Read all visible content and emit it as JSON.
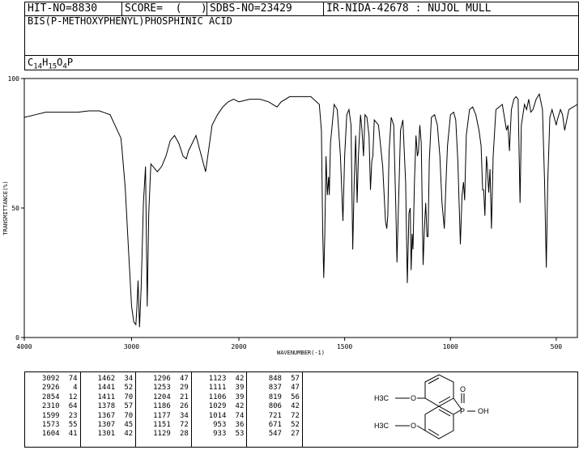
{
  "header": {
    "hit_no": "HIT-NO=8830",
    "score": "SCORE=  (   )",
    "sdbs_no": "SDBS-NO=23429",
    "ir_info": "IR-NIDA-42678 : NUJOL MULL"
  },
  "compound": {
    "name": "BIS(P-METHOXYPHENYL)PHOSPHINIC ACID",
    "formula_parts": [
      {
        "t": "C",
        "sub": false
      },
      {
        "t": "14",
        "sub": true
      },
      {
        "t": "H",
        "sub": false
      },
      {
        "t": "15",
        "sub": true
      },
      {
        "t": "O",
        "sub": false
      },
      {
        "t": "4",
        "sub": true
      },
      {
        "t": "P",
        "sub": false
      }
    ]
  },
  "chart_data": {
    "type": "line",
    "xlabel": "WAVENUMBER(-1)",
    "ylabel": "TRANSMITTANCE(%)",
    "xlim": [
      4000,
      400
    ],
    "ylim": [
      0,
      100
    ],
    "x_ticks": [
      4000,
      3000,
      2000,
      1500,
      1000,
      500
    ],
    "y_ticks": [
      0,
      50,
      100
    ],
    "series": [
      {
        "points": [
          [
            4000,
            85
          ],
          [
            3900,
            86
          ],
          [
            3800,
            87
          ],
          [
            3700,
            87
          ],
          [
            3600,
            87
          ],
          [
            3500,
            87
          ],
          [
            3400,
            87.5
          ],
          [
            3300,
            87.5
          ],
          [
            3200,
            86
          ],
          [
            3100,
            77
          ],
          [
            3092,
            74
          ],
          [
            3060,
            58
          ],
          [
            3030,
            35
          ],
          [
            3000,
            12
          ],
          [
            2980,
            6
          ],
          [
            2960,
            5
          ],
          [
            2950,
            12
          ],
          [
            2940,
            22
          ],
          [
            2926,
            4
          ],
          [
            2910,
            20
          ],
          [
            2890,
            52
          ],
          [
            2870,
            66
          ],
          [
            2854,
            12
          ],
          [
            2840,
            48
          ],
          [
            2820,
            67
          ],
          [
            2800,
            66
          ],
          [
            2760,
            64
          ],
          [
            2720,
            66
          ],
          [
            2680,
            70
          ],
          [
            2640,
            76
          ],
          [
            2600,
            78
          ],
          [
            2560,
            75
          ],
          [
            2520,
            70
          ],
          [
            2490,
            69
          ],
          [
            2470,
            72
          ],
          [
            2400,
            78
          ],
          [
            2310,
            64
          ],
          [
            2250,
            82
          ],
          [
            2200,
            86
          ],
          [
            2150,
            89
          ],
          [
            2100,
            91
          ],
          [
            2050,
            92
          ],
          [
            2000,
            91
          ],
          [
            1950,
            92
          ],
          [
            1900,
            92
          ],
          [
            1860,
            91
          ],
          [
            1820,
            89
          ],
          [
            1800,
            91
          ],
          [
            1760,
            93
          ],
          [
            1700,
            93
          ],
          [
            1660,
            93
          ],
          [
            1620,
            90
          ],
          [
            1610,
            80
          ],
          [
            1604,
            41
          ],
          [
            1599,
            23
          ],
          [
            1594,
            40
          ],
          [
            1588,
            70
          ],
          [
            1582,
            55
          ],
          [
            1576,
            62
          ],
          [
            1573,
            55
          ],
          [
            1567,
            75
          ],
          [
            1550,
            90
          ],
          [
            1535,
            88
          ],
          [
            1520,
            70
          ],
          [
            1508,
            45
          ],
          [
            1500,
            70
          ],
          [
            1490,
            86
          ],
          [
            1480,
            88
          ],
          [
            1470,
            82
          ],
          [
            1462,
            34
          ],
          [
            1455,
            60
          ],
          [
            1448,
            78
          ],
          [
            1441,
            52
          ],
          [
            1435,
            70
          ],
          [
            1425,
            86
          ],
          [
            1418,
            80
          ],
          [
            1411,
            70
          ],
          [
            1404,
            86
          ],
          [
            1395,
            85
          ],
          [
            1385,
            78
          ],
          [
            1378,
            57
          ],
          [
            1372,
            68
          ],
          [
            1367,
            70
          ],
          [
            1360,
            84
          ],
          [
            1340,
            82
          ],
          [
            1330,
            74
          ],
          [
            1320,
            66
          ],
          [
            1307,
            45
          ],
          [
            1301,
            42
          ],
          [
            1296,
            47
          ],
          [
            1290,
            72
          ],
          [
            1280,
            85
          ],
          [
            1268,
            82
          ],
          [
            1258,
            50
          ],
          [
            1253,
            29
          ],
          [
            1246,
            50
          ],
          [
            1236,
            80
          ],
          [
            1225,
            84
          ],
          [
            1212,
            60
          ],
          [
            1204,
            21
          ],
          [
            1196,
            48
          ],
          [
            1190,
            50
          ],
          [
            1186,
            26
          ],
          [
            1181,
            40
          ],
          [
            1177,
            34
          ],
          [
            1170,
            60
          ],
          [
            1163,
            78
          ],
          [
            1156,
            70
          ],
          [
            1151,
            72
          ],
          [
            1145,
            82
          ],
          [
            1138,
            75
          ],
          [
            1129,
            28
          ],
          [
            1123,
            42
          ],
          [
            1117,
            52
          ],
          [
            1111,
            39
          ],
          [
            1106,
            39
          ],
          [
            1100,
            68
          ],
          [
            1090,
            85
          ],
          [
            1075,
            86
          ],
          [
            1062,
            82
          ],
          [
            1050,
            70
          ],
          [
            1040,
            52
          ],
          [
            1029,
            42
          ],
          [
            1020,
            62
          ],
          [
            1014,
            74
          ],
          [
            1000,
            86
          ],
          [
            985,
            87
          ],
          [
            975,
            84
          ],
          [
            965,
            68
          ],
          [
            953,
            36
          ],
          [
            945,
            55
          ],
          [
            938,
            60
          ],
          [
            933,
            53
          ],
          [
            925,
            78
          ],
          [
            910,
            88
          ],
          [
            895,
            89
          ],
          [
            880,
            86
          ],
          [
            865,
            80
          ],
          [
            855,
            74
          ],
          [
            848,
            57
          ],
          [
            843,
            57
          ],
          [
            837,
            47
          ],
          [
            830,
            70
          ],
          [
            825,
            65
          ],
          [
            819,
            56
          ],
          [
            813,
            65
          ],
          [
            806,
            42
          ],
          [
            798,
            70
          ],
          [
            785,
            88
          ],
          [
            770,
            89
          ],
          [
            755,
            90
          ],
          [
            745,
            85
          ],
          [
            735,
            80
          ],
          [
            728,
            82
          ],
          [
            721,
            72
          ],
          [
            712,
            88
          ],
          [
            700,
            92
          ],
          [
            690,
            93
          ],
          [
            680,
            92
          ],
          [
            671,
            52
          ],
          [
            665,
            82
          ],
          [
            650,
            90
          ],
          [
            640,
            88
          ],
          [
            630,
            92
          ],
          [
            620,
            87
          ],
          [
            610,
            88
          ],
          [
            595,
            92
          ],
          [
            580,
            94
          ],
          [
            565,
            88
          ],
          [
            555,
            60
          ],
          [
            547,
            27
          ],
          [
            540,
            60
          ],
          [
            530,
            85
          ],
          [
            520,
            88
          ],
          [
            510,
            85
          ],
          [
            500,
            82
          ],
          [
            495,
            84
          ],
          [
            480,
            88
          ],
          [
            470,
            86
          ],
          [
            460,
            80
          ],
          [
            450,
            84
          ],
          [
            440,
            88
          ],
          [
            420,
            89
          ],
          [
            400,
            90
          ]
        ]
      }
    ]
  },
  "peak_table": {
    "columns": [
      [
        [
          "3092",
          "74"
        ],
        [
          "2926",
          "4"
        ],
        [
          "2854",
          "12"
        ],
        [
          "2310",
          "64"
        ],
        [
          "1599",
          "23"
        ],
        [
          "1573",
          "55"
        ],
        [
          "1604",
          "41"
        ]
      ],
      [
        [
          "1462",
          "34"
        ],
        [
          "1441",
          "52"
        ],
        [
          "1411",
          "70"
        ],
        [
          "1378",
          "57"
        ],
        [
          "1367",
          "70"
        ],
        [
          "1307",
          "45"
        ],
        [
          "1301",
          "42"
        ]
      ],
      [
        [
          "1296",
          "47"
        ],
        [
          "1253",
          "29"
        ],
        [
          "1204",
          "21"
        ],
        [
          "1186",
          "26"
        ],
        [
          "1177",
          "34"
        ],
        [
          "1151",
          "72"
        ],
        [
          "1129",
          "28"
        ]
      ],
      [
        [
          "1123",
          "42"
        ],
        [
          "1111",
          "39"
        ],
        [
          "1106",
          "39"
        ],
        [
          "1029",
          "42"
        ],
        [
          "1014",
          "74"
        ],
        [
          "953",
          "36"
        ],
        [
          "933",
          "53"
        ]
      ],
      [
        [
          "848",
          "57"
        ],
        [
          "837",
          "47"
        ],
        [
          "819",
          "56"
        ],
        [
          "806",
          "42"
        ],
        [
          "721",
          "72"
        ],
        [
          "671",
          "52"
        ],
        [
          "547",
          "27"
        ]
      ]
    ]
  },
  "structure": {
    "label_o_double": "O",
    "label_p": "P",
    "label_oh": "OH",
    "label_ch3o_top": "H3C",
    "label_ch3o_bottom": "H3C",
    "label_o1": "O",
    "label_o2": "O"
  }
}
